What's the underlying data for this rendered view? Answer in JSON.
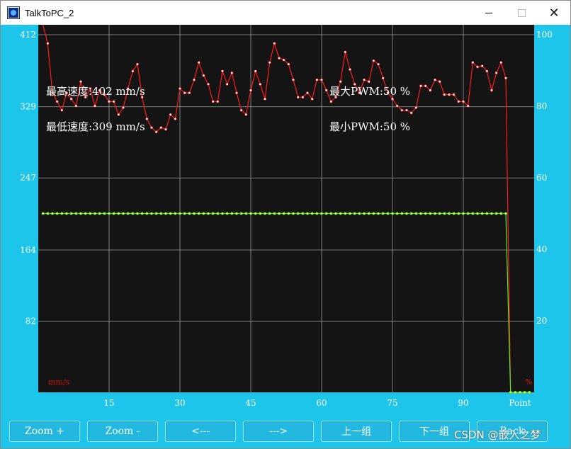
{
  "window": {
    "title": "TalkToPC_2",
    "controls": {
      "minimize": "—",
      "maximize": "☐",
      "close": "✕"
    }
  },
  "chart_data": {
    "type": "line",
    "left_axis": {
      "unit_label": "mm/s",
      "ticks": [
        "412",
        "329",
        "247",
        "164",
        "82"
      ],
      "ylim": [
        0,
        412
      ]
    },
    "right_axis": {
      "unit_label": "%",
      "ticks": [
        "100",
        "80",
        "60",
        "40",
        "20"
      ],
      "ylim": [
        0,
        100
      ]
    },
    "x_axis": {
      "ticks": [
        "15",
        "30",
        "45",
        "60",
        "75",
        "90"
      ],
      "end_label": "Point",
      "xlim": [
        0,
        105
      ]
    },
    "annotations": {
      "max_speed": "最高速度:402 mm/s",
      "min_speed": "最低速度:309 mm/s",
      "max_pwm": "最大PWM:50 %",
      "min_pwm": "最小PWM:50 %"
    },
    "series": [
      {
        "axis": "left",
        "color": "#ff1a1a",
        "x": [
          1,
          2,
          3,
          4,
          5,
          6,
          7,
          8,
          9,
          10,
          11,
          12,
          13,
          14,
          15,
          16,
          17,
          18,
          19,
          20,
          21,
          22,
          23,
          24,
          25,
          26,
          27,
          28,
          29,
          30,
          31,
          32,
          33,
          34,
          35,
          36,
          37,
          38,
          39,
          40,
          41,
          42,
          43,
          44,
          45,
          46,
          47,
          48,
          49,
          50,
          51,
          52,
          53,
          54,
          55,
          56,
          57,
          58,
          59,
          60,
          61,
          62,
          63,
          64,
          65,
          66,
          67,
          68,
          69,
          70,
          71,
          72,
          73,
          74,
          75,
          76,
          77,
          78,
          79,
          80,
          81,
          82,
          83,
          84,
          85,
          86,
          87,
          88,
          89,
          90,
          91,
          92,
          93,
          94,
          95,
          96,
          97,
          98,
          99,
          100,
          101,
          102,
          103,
          104
        ],
        "values": [
          500,
          402,
          345,
          335,
          325,
          345,
          338,
          330,
          358,
          340,
          350,
          330,
          348,
          343,
          335,
          335,
          320,
          328,
          350,
          370,
          378,
          340,
          315,
          305,
          300,
          305,
          303,
          320,
          315,
          350,
          345,
          345,
          360,
          380,
          365,
          355,
          335,
          335,
          370,
          355,
          368,
          345,
          325,
          320,
          348,
          370,
          355,
          338,
          380,
          402,
          385,
          383,
          378,
          360,
          340,
          340,
          345,
          338,
          360,
          360,
          348,
          335,
          340,
          358,
          392,
          372,
          355,
          345,
          360,
          358,
          382,
          378,
          362,
          345,
          338,
          330,
          325,
          325,
          322,
          328,
          353,
          353,
          348,
          360,
          358,
          343,
          343,
          343,
          335,
          335,
          330,
          380,
          375,
          376,
          370,
          348,
          368,
          380,
          362,
          0,
          0,
          0,
          0,
          0
        ]
      },
      {
        "axis": "right",
        "color": "#55ee22",
        "x": [
          1,
          2,
          3,
          4,
          5,
          6,
          7,
          8,
          9,
          10,
          11,
          12,
          13,
          14,
          15,
          16,
          17,
          18,
          19,
          20,
          21,
          22,
          23,
          24,
          25,
          26,
          27,
          28,
          29,
          30,
          31,
          32,
          33,
          34,
          35,
          36,
          37,
          38,
          39,
          40,
          41,
          42,
          43,
          44,
          45,
          46,
          47,
          48,
          49,
          50,
          51,
          52,
          53,
          54,
          55,
          56,
          57,
          58,
          59,
          60,
          61,
          62,
          63,
          64,
          65,
          66,
          67,
          68,
          69,
          70,
          71,
          72,
          73,
          74,
          75,
          76,
          77,
          78,
          79,
          80,
          81,
          82,
          83,
          84,
          85,
          86,
          87,
          88,
          89,
          90,
          91,
          92,
          93,
          94,
          95,
          96,
          97,
          98,
          99,
          100,
          101,
          102,
          103,
          104
        ],
        "values": [
          50,
          50,
          50,
          50,
          50,
          50,
          50,
          50,
          50,
          50,
          50,
          50,
          50,
          50,
          50,
          50,
          50,
          50,
          50,
          50,
          50,
          50,
          50,
          50,
          50,
          50,
          50,
          50,
          50,
          50,
          50,
          50,
          50,
          50,
          50,
          50,
          50,
          50,
          50,
          50,
          50,
          50,
          50,
          50,
          50,
          50,
          50,
          50,
          50,
          50,
          50,
          50,
          50,
          50,
          50,
          50,
          50,
          50,
          50,
          50,
          50,
          50,
          50,
          50,
          50,
          50,
          50,
          50,
          50,
          50,
          50,
          50,
          50,
          50,
          50,
          50,
          50,
          50,
          50,
          50,
          50,
          50,
          50,
          50,
          50,
          50,
          50,
          50,
          50,
          50,
          50,
          50,
          50,
          50,
          50,
          50,
          50,
          50,
          50,
          0,
          0,
          0,
          0,
          0
        ]
      }
    ],
    "colors": {
      "plot_bg": "#141414",
      "frame_bg": "#1ec5ea",
      "grid": "#9a9a9a",
      "axis_text": "#ffffff",
      "unit_text": "#cc1111"
    }
  },
  "buttons": [
    {
      "name": "zoom-in-button",
      "label": "Zoom +"
    },
    {
      "name": "zoom-out-button",
      "label": "Zoom -"
    },
    {
      "name": "scroll-left-button",
      "label": "<---"
    },
    {
      "name": "scroll-right-button",
      "label": "--->"
    },
    {
      "name": "prev-group-button",
      "label": "上一组"
    },
    {
      "name": "next-group-button",
      "label": "下一组"
    },
    {
      "name": "back-button",
      "label": "Back"
    }
  ],
  "watermark": "CSDN @嵌入之梦"
}
